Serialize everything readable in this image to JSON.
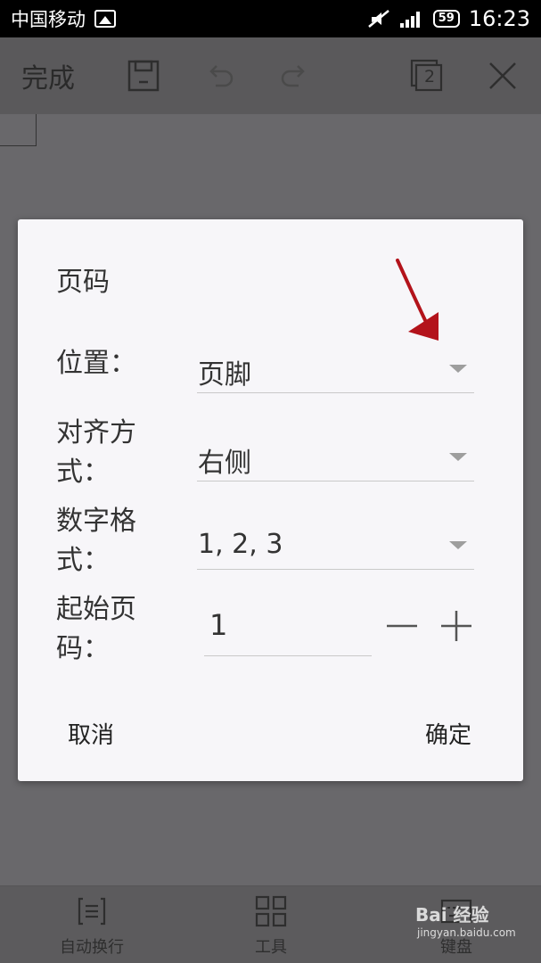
{
  "status_bar": {
    "carrier": "中国移动",
    "battery": "59",
    "time": "16:23"
  },
  "toolbar": {
    "done_label": "完成",
    "page_count": "2"
  },
  "dialog": {
    "title": "页码",
    "position": {
      "label": "位置：",
      "value": "页脚"
    },
    "alignment": {
      "label": "对齐方式：",
      "value": "右侧"
    },
    "number_format": {
      "label": "数字格式：",
      "value": "1, 2, 3"
    },
    "start_page": {
      "label": "起始页码：",
      "value": "1"
    },
    "cancel_label": "取消",
    "ok_label": "确定"
  },
  "bottom_bar": {
    "items": [
      {
        "label": "自动换行",
        "icon": "wrap-text-icon"
      },
      {
        "label": "工具",
        "icon": "grid-tools-icon"
      },
      {
        "label": "键盘",
        "icon": "keyboard-icon"
      }
    ]
  },
  "watermark": {
    "text": "Bai 经验",
    "sub": "jingyan.baidu.com"
  },
  "colors": {
    "annotation_arrow": "#b3131b",
    "overlay": "#69686b",
    "dialog_bg": "#f7f6f9"
  }
}
